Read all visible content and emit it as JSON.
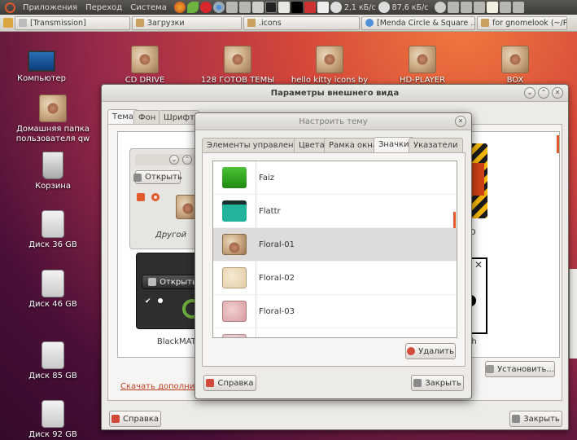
{
  "top_panel": {
    "menus": [
      "Приложения",
      "Переход",
      "Система"
    ],
    "net_down": "2,1 кБ/с",
    "net_up": "87,6 кБ/с"
  },
  "taskbar": {
    "tasks": [
      "[Transmission]",
      "Загрузки",
      ".icons",
      "[Menda Circle & Square ...",
      "for gnomelook (~/Pi"
    ]
  },
  "desktop": {
    "icons": [
      {
        "label": "Компьютер"
      },
      {
        "label": "Домашняя папка пользователя qw"
      },
      {
        "label": "Корзина"
      },
      {
        "label": "Диск 36 GB"
      },
      {
        "label": "Диск 46 GB"
      },
      {
        "label": "Диск 85 GB"
      },
      {
        "label": "Диск 92 GB"
      },
      {
        "label": "CD DRIVE"
      },
      {
        "label": "128 ГОТОВ ТЕМЫ"
      },
      {
        "label": "hello kitty icons by"
      },
      {
        "label": "HD-PLAYER"
      },
      {
        "label": "BOX"
      }
    ]
  },
  "main_window": {
    "title": "Параметры внешнего вида",
    "tabs": [
      "Тема",
      "Фон",
      "Шрифт"
    ],
    "theme_cards": [
      {
        "name": "Другой",
        "button": "Открыть"
      },
      {
        "name": "BlackMATE",
        "button": "Открыть"
      },
      {
        "name": "D"
      },
      {
        "name": "nh"
      }
    ],
    "download_link": "Скачать дополнител",
    "install_button": "Установить...",
    "help_button": "Справка",
    "close_button": "Закрыть"
  },
  "dialog": {
    "title": "Настроить тему",
    "tabs": [
      "Элементы управления",
      "Цвета",
      "Рамка окна",
      "Значки",
      "Указатели"
    ],
    "active_tab": "Значки",
    "icon_themes": [
      "Faiz",
      "Flattr",
      "Floral-01",
      "Floral-02",
      "Floral-03"
    ],
    "selected": "Floral-01",
    "delete_button": "Удалить",
    "help_button": "Справка",
    "close_button": "Закрыть"
  },
  "colors": {
    "accent": "#e2592a",
    "faiz_folder": "#2fa11c",
    "flattr_folder": "#22b39b"
  }
}
